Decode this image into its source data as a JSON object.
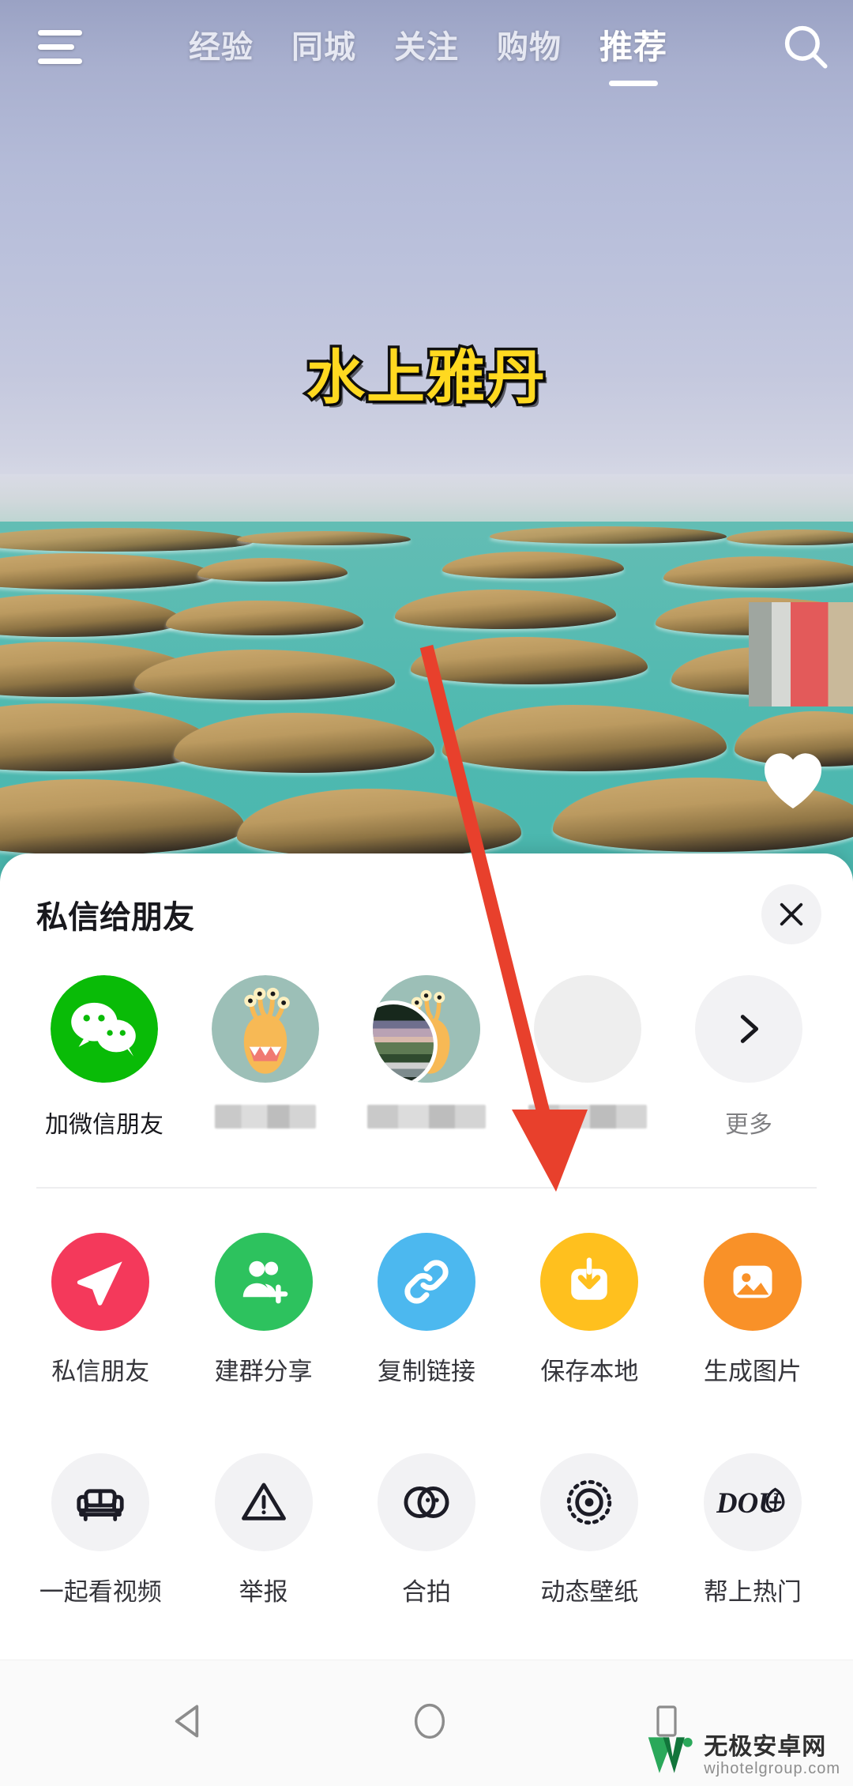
{
  "topnav": {
    "menu_icon": "hamburger-icon",
    "search_icon": "search-icon",
    "tabs": [
      {
        "label": "经验",
        "active": false
      },
      {
        "label": "同城",
        "active": false
      },
      {
        "label": "关注",
        "active": false
      },
      {
        "label": "购物",
        "active": false
      },
      {
        "label": "推荐",
        "active": true
      }
    ]
  },
  "video": {
    "caption_title": "水上雅丹",
    "caption_color": "#ffd920",
    "caption_outline": "#111111",
    "heart_icon": "heart-icon",
    "avatar_icon": "mosaic-avatar"
  },
  "annotation": {
    "arrow_color": "#e8402c",
    "arrow_icon": "red-arrow-annotation"
  },
  "sheet": {
    "title": "私信给朋友",
    "close_icon": "close-icon",
    "friends": [
      {
        "name": "加微信朋友",
        "avatar": "wechat-icon",
        "blurred": false
      },
      {
        "name": "",
        "avatar": "monster-avatar",
        "blurred": true
      },
      {
        "name": "",
        "avatar": "landscape-avatar-overlap",
        "blurred": true
      },
      {
        "name": "",
        "avatar": "landscape-avatar",
        "blurred": true
      },
      {
        "name": "更多",
        "avatar": "chevron-right-icon",
        "blurred": true
      }
    ],
    "actions_row1": [
      {
        "label": "私信朋友",
        "icon": "send-plane-icon",
        "color": "#f4395b"
      },
      {
        "label": "建群分享",
        "icon": "group-add-icon",
        "color": "#2dc25e"
      },
      {
        "label": "复制链接",
        "icon": "link-icon",
        "color": "#4cb8ef"
      },
      {
        "label": "保存本地",
        "icon": "download-icon",
        "color": "#ffc01e"
      },
      {
        "label": "生成图片",
        "icon": "image-icon",
        "color": "#f99128"
      }
    ],
    "actions_row2": [
      {
        "label": "一起看视频",
        "icon": "sofa-icon",
        "color": "#f2f2f4"
      },
      {
        "label": "举报",
        "icon": "warning-triangle-icon",
        "color": "#f2f2f4"
      },
      {
        "label": "合拍",
        "icon": "duet-circles-icon",
        "color": "#f2f2f4"
      },
      {
        "label": "动态壁纸",
        "icon": "dotted-target-icon",
        "color": "#f2f2f4"
      },
      {
        "label": "帮上热门",
        "icon": "dou-plus-icon",
        "color": "#f2f2f4"
      }
    ]
  },
  "android_nav": {
    "back_icon": "back-triangle-icon",
    "home_icon": "home-circle-icon",
    "recents_icon": "recents-square-icon"
  },
  "watermark": {
    "logo_icon": "w-logo-icon",
    "cn": "无极安卓网",
    "en": "wjhotelgroup.com",
    "color": "#20a050"
  }
}
